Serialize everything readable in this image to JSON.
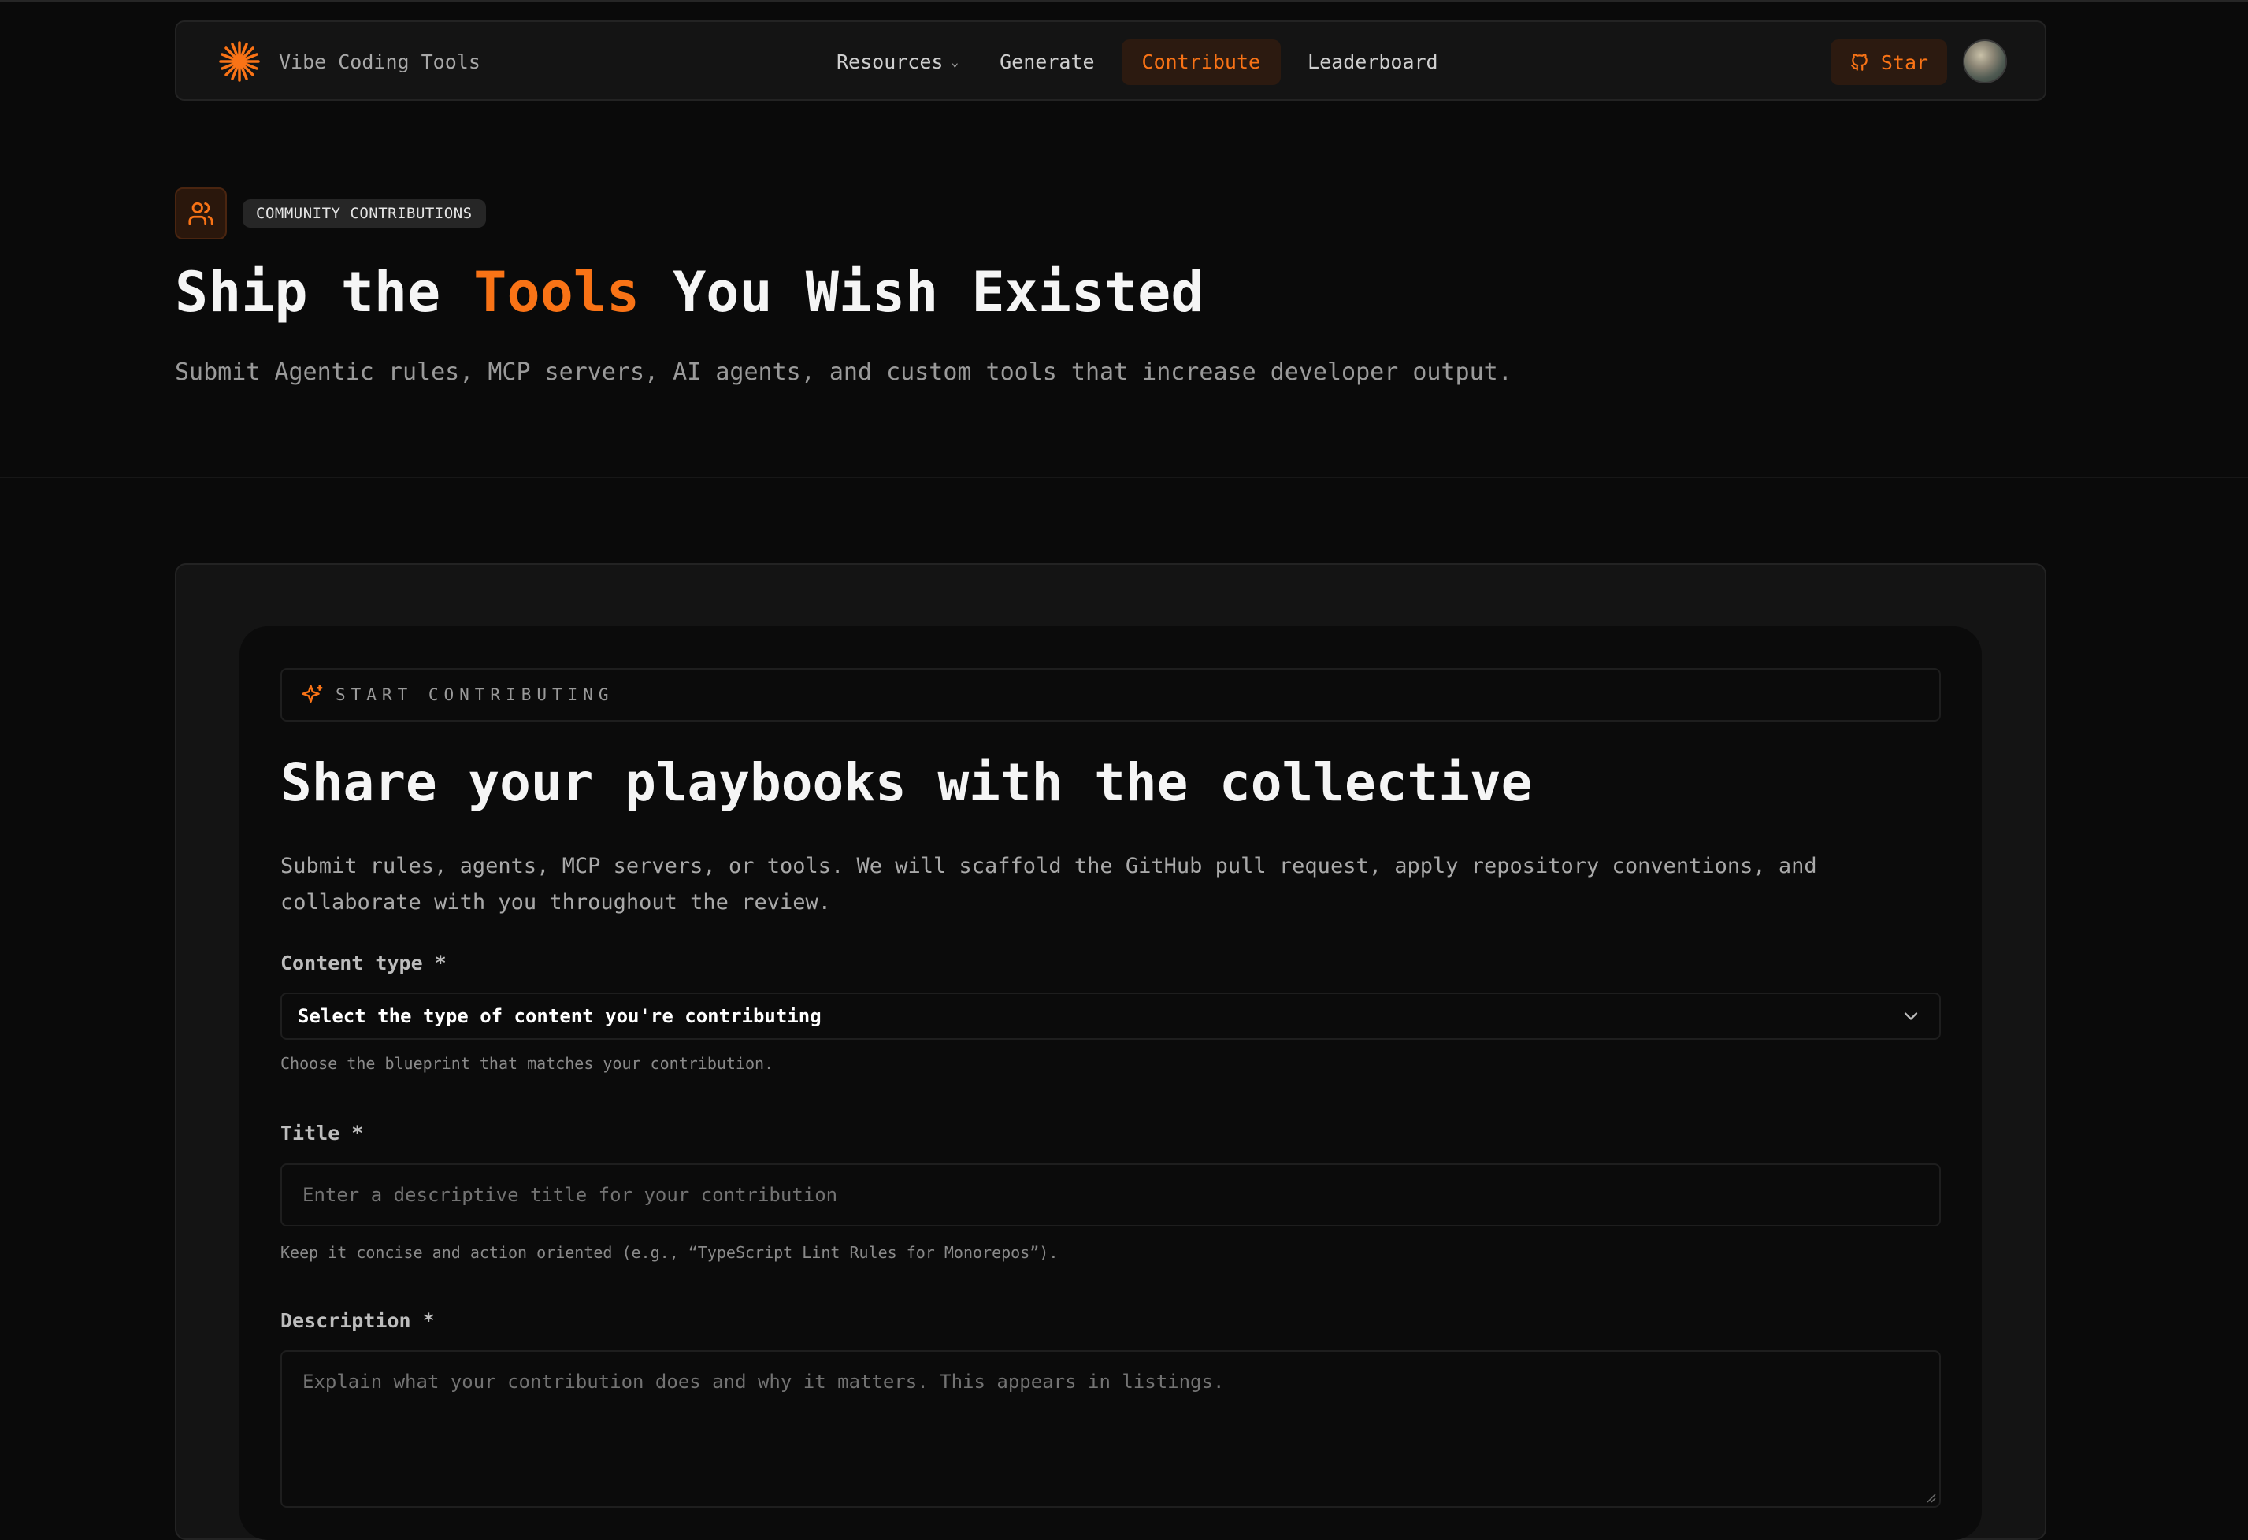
{
  "nav": {
    "brand": "Vibe Coding Tools",
    "links": [
      {
        "label": "Resources",
        "has_dropdown": true
      },
      {
        "label": "Generate"
      },
      {
        "label": "Contribute",
        "active": true
      },
      {
        "label": "Leaderboard"
      }
    ],
    "star_label": "Star"
  },
  "hero": {
    "badge": "COMMUNITY CONTRIBUTIONS",
    "title_before": "Ship the ",
    "title_accent": "Tools",
    "title_after": " You Wish Existed",
    "subtitle": "Submit Agentic rules, MCP servers, AI agents, and custom tools that increase developer output."
  },
  "form": {
    "eyebrow": "START CONTRIBUTING",
    "title": "Share your playbooks with the collective",
    "description": "Submit rules, agents, MCP servers, or tools. We will scaffold the GitHub pull request, apply repository conventions, and collaborate with you throughout the review.",
    "content_type": {
      "label": "Content type *",
      "value": "Select the type of content you're contributing",
      "hint": "Choose the blueprint that matches your contribution."
    },
    "title_field": {
      "label": "Title *",
      "placeholder": "Enter a descriptive title for your contribution",
      "hint": "Keep it concise and action oriented (e.g., “TypeScript Lint Rules for Monorepos”)."
    },
    "description_field": {
      "label": "Description *",
      "placeholder": "Explain what your contribution does and why it matters. This appears in listings."
    }
  },
  "colors": {
    "accent": "#f97316",
    "background": "#0a0a0a",
    "surface": "#141414"
  },
  "icons": {
    "brand": "sunburst-logo-icon",
    "hero": "users-icon",
    "eyebrow": "sparkles-icon",
    "star": "github-icon"
  }
}
